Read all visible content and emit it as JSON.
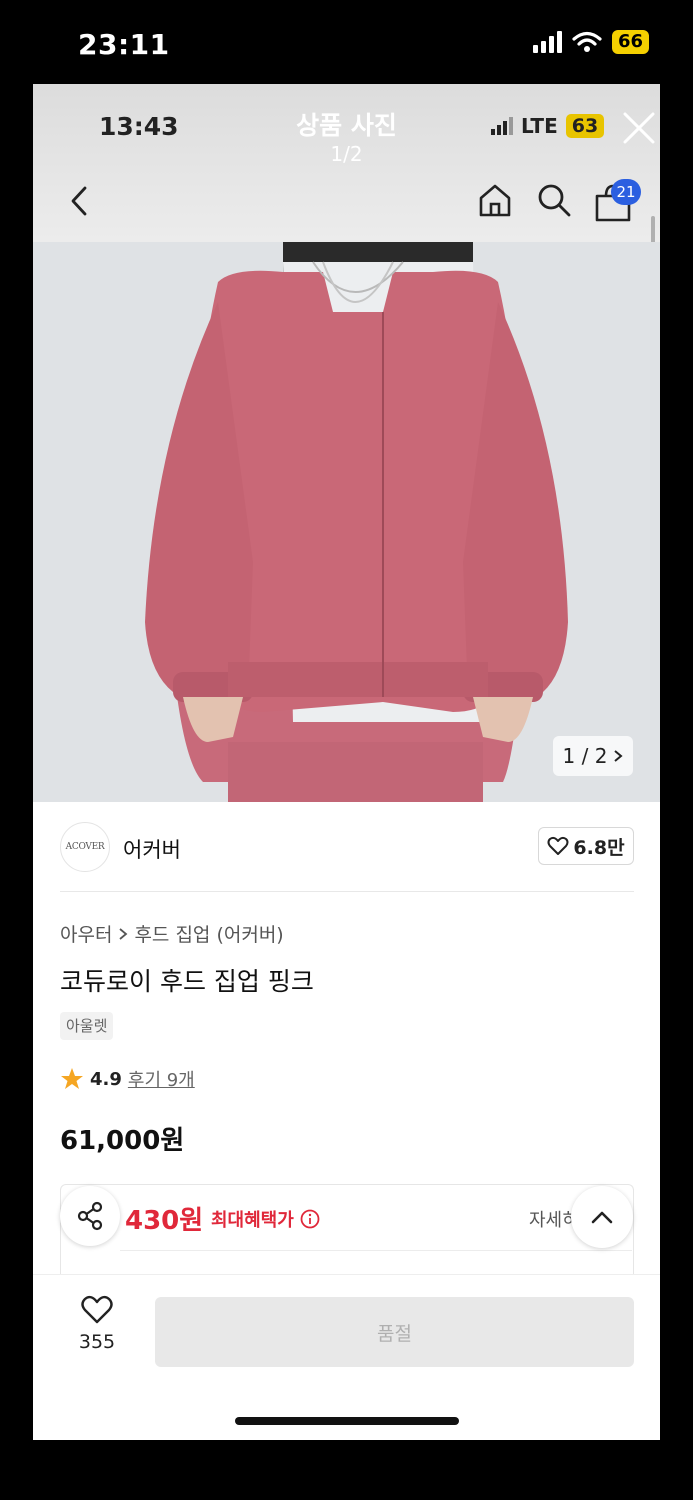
{
  "outer_status": {
    "time": "23:11",
    "battery": "66"
  },
  "inner_status": {
    "time": "13:43",
    "network": "LTE",
    "battery": "63"
  },
  "viewer": {
    "title": "상품 사진",
    "counter": "1/2"
  },
  "nav": {
    "cart_count": "21"
  },
  "image": {
    "counter_label": "1 / 2"
  },
  "brand": {
    "logo_text": "ACOVER",
    "name": "어커버",
    "likes": "6.8만"
  },
  "breadcrumb": {
    "category": "아우터",
    "subcategory": "후드 집업 (어커버)"
  },
  "product": {
    "title": "코듀로이 후드 집업 핑크",
    "tag": "아울렛",
    "rating": "4.9",
    "reviews": "후기 9개",
    "price": "61,000원"
  },
  "benefit": {
    "amount": "430원",
    "label": "최대혜택가",
    "detail": "자세히"
  },
  "bottom": {
    "wish_count": "355",
    "action_label": "품절"
  },
  "colors": {
    "accent_red": "#e0283a",
    "badge_blue": "#2b5fe0",
    "star": "#f5a623"
  }
}
